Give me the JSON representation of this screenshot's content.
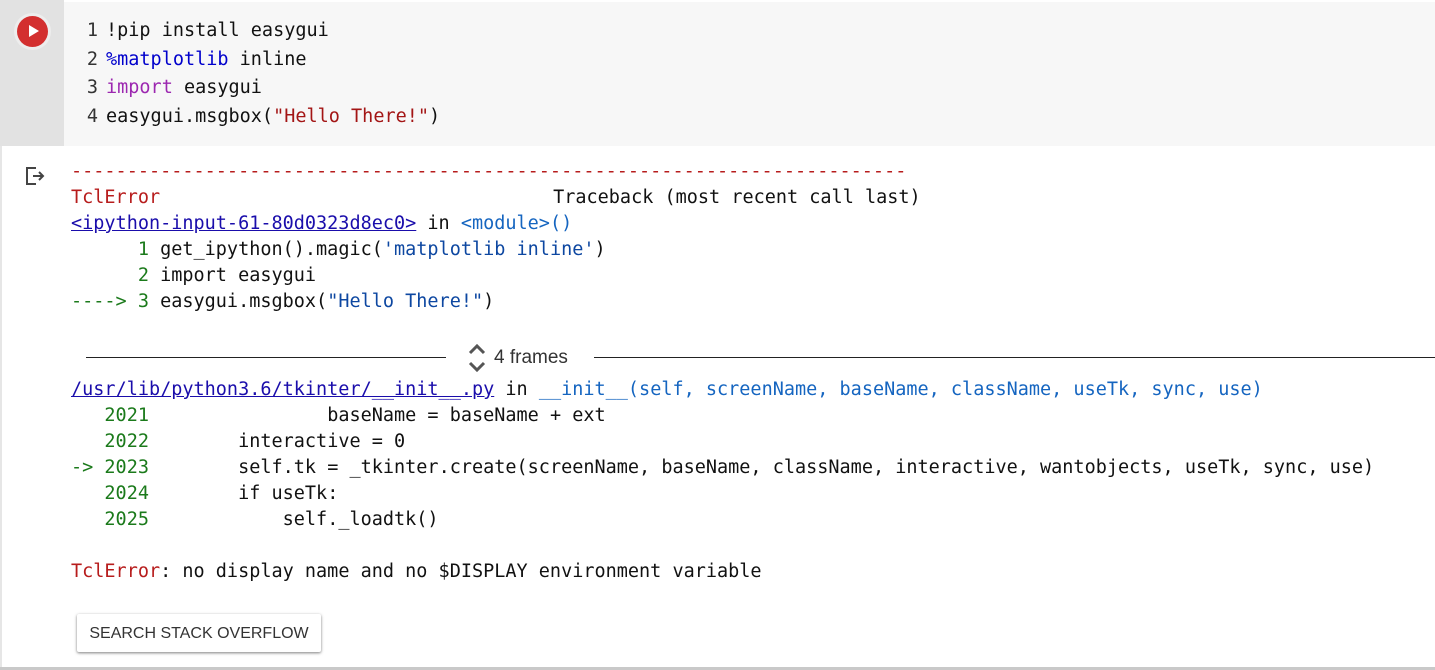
{
  "cell": {
    "code_lines": [
      {
        "num": "1",
        "parts": [
          {
            "t": "!pip install easygui",
            "c": ""
          }
        ]
      },
      {
        "num": "2",
        "parts": [
          {
            "t": "%matplotlib",
            "c": "kw-magic"
          },
          {
            "t": " inline",
            "c": ""
          }
        ]
      },
      {
        "num": "3",
        "parts": [
          {
            "t": "import",
            "c": "kw-import"
          },
          {
            "t": " easygui",
            "c": ""
          }
        ]
      },
      {
        "num": "4",
        "parts": [
          {
            "t": "easygui.msgbox(",
            "c": ""
          },
          {
            "t": "\"Hello There!\"",
            "c": "str"
          },
          {
            "t": ")",
            "c": ""
          }
        ]
      }
    ]
  },
  "output": {
    "separator": "---------------------------------------------------------------------------",
    "error_name": "TclError",
    "traceback_header": "Traceback (most recent call last)",
    "input_link": "<ipython-input-61-80d0323d8ec0>",
    "in_word": " in ",
    "module_text": "<module>()",
    "frame1_lines": [
      {
        "prefix": "      ",
        "num": "1",
        "code": "get_ipython().magic(",
        "str": "'matplotlib inline'",
        "end": ")"
      },
      {
        "prefix": "      ",
        "num": "2",
        "code": "import easygui",
        "str": "",
        "end": ""
      },
      {
        "prefix": "----> ",
        "num": "3",
        "code": "easygui.msgbox(",
        "str": "\"Hello There!\"",
        "end": ")"
      }
    ],
    "frames_label": "4 frames",
    "file_link": "/usr/lib/python3.6/tkinter/__init__.py",
    "func_sig": "__init__(self, screenName, baseName, className, useTk, sync, use)",
    "frame2_lines": [
      {
        "prefix": "   ",
        "num": "2021",
        "code": "                baseName = baseName + ext"
      },
      {
        "prefix": "   ",
        "num": "2022",
        "code": "        interactive = 0"
      },
      {
        "prefix": "-> ",
        "num": "2023",
        "code": "        self.tk = _tkinter.create(screenName, baseName, className, interactive, wantobjects, useTk, sync, use)"
      },
      {
        "prefix": "   ",
        "num": "2024",
        "code": "        if useTk:"
      },
      {
        "prefix": "   ",
        "num": "2025",
        "code": "            self._loadtk()"
      }
    ],
    "final_error_name": "TclError",
    "final_error_msg": ": no display name and no $DISPLAY environment variable",
    "so_button_label": "SEARCH STACK OVERFLOW"
  },
  "icons": {
    "run": "play-icon",
    "output": "output-redirect-icon",
    "frames": "expand-chevrons-icon"
  },
  "colors": {
    "run_button": "#d32f2f",
    "error": "#b71c1c",
    "link": "#1a0dab",
    "gutter": "#e2e2e2",
    "editor_bg": "#f7f7f7"
  }
}
